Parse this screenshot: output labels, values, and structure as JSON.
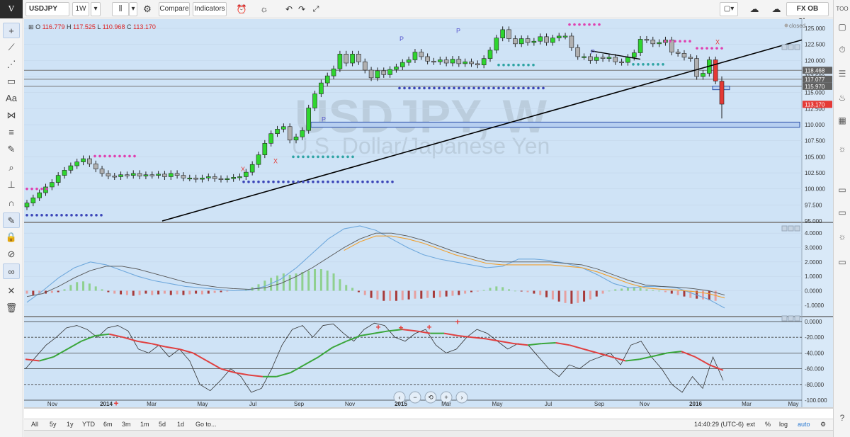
{
  "toolbar": {
    "logo": "V",
    "symbol": "USDJPY",
    "interval": "1W",
    "compare": "Compare",
    "indicators": "Indicators",
    "layout_name": "FX OB Clean",
    "right_label": "TOO"
  },
  "legend": {
    "o_label": "O",
    "o_value": "116.779",
    "h_label": "H",
    "h_value": "117.525",
    "l_label": "L",
    "l_value": "110.968",
    "c_label": "C",
    "c_value": "113.170"
  },
  "watermark": {
    "title": "USDJPY, W",
    "subtitle": "U.S. Dollar/Japanese Yen"
  },
  "status": {
    "closed": "closed"
  },
  "price_axis": {
    "labels": [
      "125.000",
      "122.500",
      "120.000",
      "117.500",
      "115.000",
      "112.500",
      "110.000",
      "107.500",
      "105.000",
      "102.500",
      "100.000",
      "97.500",
      "95.000"
    ],
    "marker_labels": [
      {
        "text": "118.468",
        "color": "#616161"
      },
      {
        "text": "117.077",
        "color": "#616161"
      },
      {
        "text": "115.970",
        "color": "#616161"
      },
      {
        "text": "113.170",
        "color": "#e53935"
      }
    ]
  },
  "macd_axis": {
    "labels": [
      "4.0000",
      "3.0000",
      "2.0000",
      "1.0000",
      "0.0000",
      "-1.0000"
    ]
  },
  "osc_axis": {
    "labels": [
      "0.0000",
      "-20.000",
      "-40.000",
      "-60.000",
      "-80.000",
      "-100.000"
    ]
  },
  "time_axis": {
    "labels": [
      {
        "text": "Nov",
        "bold": false
      },
      {
        "text": "2014",
        "bold": true
      },
      {
        "text": "Mar",
        "bold": false
      },
      {
        "text": "May",
        "bold": false
      },
      {
        "text": "Jul",
        "bold": false
      },
      {
        "text": "Sep",
        "bold": false
      },
      {
        "text": "Nov",
        "bold": false
      },
      {
        "text": "2015",
        "bold": true
      },
      {
        "text": "Mar",
        "bold": false
      },
      {
        "text": "May",
        "bold": false
      },
      {
        "text": "Jul",
        "bold": false
      },
      {
        "text": "Sep",
        "bold": false
      },
      {
        "text": "Nov",
        "bold": false
      },
      {
        "text": "2016",
        "bold": true
      },
      {
        "text": "Mar",
        "bold": false
      },
      {
        "text": "May",
        "bold": false
      }
    ]
  },
  "pattern_labels": {
    "pivot": "P",
    "cross": "X",
    "plus": "+"
  },
  "range_buttons": [
    "All",
    "5y",
    "1y",
    "YTD",
    "6m",
    "3m",
    "1m",
    "5d",
    "1d",
    "Go to..."
  ],
  "range_right": {
    "time": "14:40:29 (UTC-6)",
    "ext": "ext",
    "pct": "%",
    "log": "log",
    "auto": "auto"
  },
  "colors": {
    "chart_bg": "#cfe3f6",
    "bull": "#2fd52f",
    "bear": "#b0b0b0",
    "alert_red": "#e53935",
    "trend_line": "#000000",
    "macd_line": "#6fa8dc",
    "signal_line": "#f0a030",
    "osc_green": "#3aa63a",
    "osc_red": "#e04040"
  },
  "chart_data": {
    "type": "candlestick",
    "symbol": "USDJPY",
    "timeframe": "1W",
    "ohlc_last": {
      "open": 116.779,
      "high": 117.525,
      "low": 110.968,
      "close": 113.17
    },
    "x_range": [
      "Nov 2013",
      "May 2016"
    ],
    "price_range": [
      95.0,
      126.0
    ],
    "closes": [
      97.8,
      98.6,
      99.4,
      100.3,
      101.0,
      102.1,
      102.9,
      103.6,
      104.2,
      104.7,
      103.9,
      103.1,
      102.4,
      102.0,
      101.9,
      102.2,
      102.1,
      102.4,
      102.0,
      102.2,
      102.1,
      102.3,
      101.9,
      102.4,
      102.1,
      101.7,
      101.7,
      101.5,
      101.7,
      101.9,
      101.6,
      101.5,
      101.6,
      101.8,
      101.9,
      102.6,
      103.8,
      105.3,
      107.1,
      108.6,
      109.3,
      109.7,
      107.6,
      108.1,
      109.1,
      112.6,
      114.8,
      116.5,
      117.6,
      118.7,
      121.0,
      119.6,
      121.0,
      119.8,
      118.5,
      117.3,
      118.4,
      117.8,
      118.6,
      119.0,
      119.7,
      120.1,
      121.3,
      120.6,
      119.9,
      119.8,
      120.1,
      119.6,
      120.2,
      119.5,
      119.8,
      119.5,
      119.3,
      120.3,
      121.6,
      123.5,
      124.8,
      123.4,
      122.6,
      123.4,
      122.8,
      123.0,
      123.7,
      122.8,
      123.5,
      123.8,
      123.8,
      122.0,
      120.6,
      120.6,
      120.0,
      120.5,
      120.3,
      120.5,
      119.8,
      119.7,
      120.5,
      121.2,
      123.3,
      123.2,
      122.6,
      122.8,
      123.2,
      121.3,
      121.1,
      120.5,
      120.3,
      117.5,
      118.0,
      120.1,
      116.8,
      113.2
    ],
    "resistance_lines": [
      118.468,
      117.077,
      115.97
    ],
    "support_zone": [
      109.6,
      110.4
    ],
    "trendline": {
      "from": {
        "date": "Feb 2014",
        "price": 95.2
      },
      "to": {
        "date": "Apr 2016",
        "price": 123.2
      }
    },
    "indicators": [
      {
        "name": "MACD",
        "range": [
          -1.5,
          4.5
        ]
      },
      {
        "name": "Oscillator",
        "range": [
          -100,
          0
        ]
      }
    ]
  }
}
